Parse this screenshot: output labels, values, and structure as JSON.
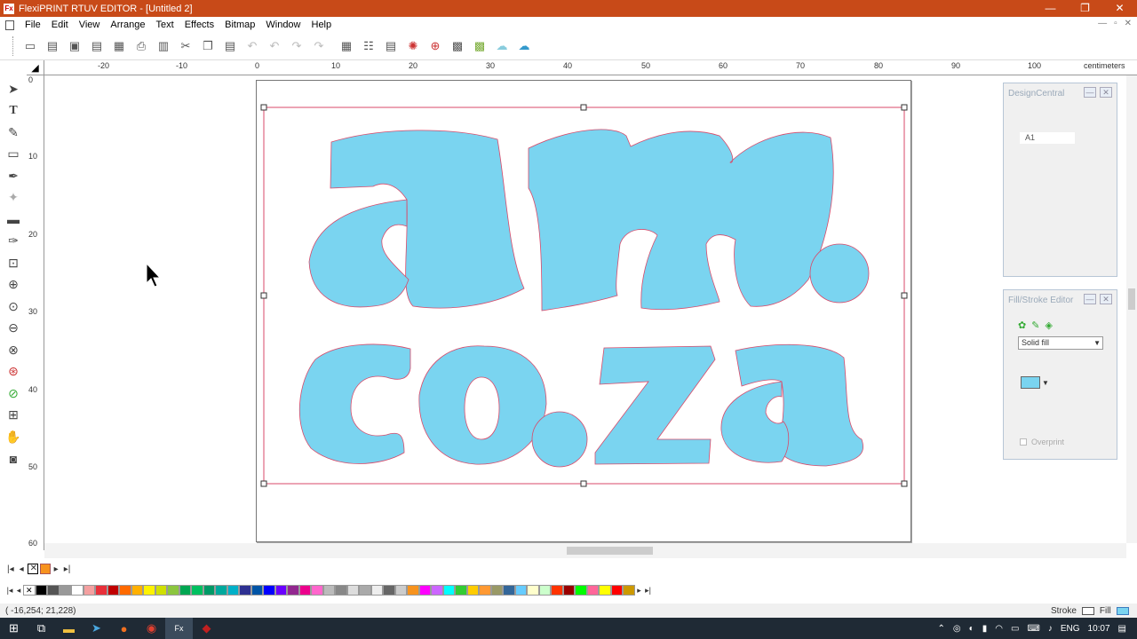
{
  "window": {
    "title": "FlexiPRINT RTUV EDITOR - [Untitled 2]",
    "app_icon": "Fx",
    "controls": [
      "—",
      "❐",
      "✕"
    ]
  },
  "menu": {
    "items": [
      "File",
      "Edit",
      "View",
      "Arrange",
      "Text",
      "Effects",
      "Bitmap",
      "Window",
      "Help"
    ],
    "mdi_controls": [
      "—",
      "▫",
      "✕"
    ]
  },
  "toolbar": {
    "icons": [
      "new-icon",
      "open-icon",
      "save-icon",
      "save-as-icon",
      "print-preview-icon",
      "print-icon",
      "rip-icon",
      "cut-icon",
      "copy-icon",
      "paste-icon",
      "undo-icon",
      "undo-all-icon",
      "redo-icon",
      "redo-all-icon",
      "arrange-icon",
      "align-icon",
      "layer-icon",
      "color-wheel-icon",
      "zoom-icon",
      "grid-icon",
      "color-icon",
      "cloud-icon",
      "upload-icon"
    ]
  },
  "ruler": {
    "unit": "centimeters",
    "h_labels": [
      "-20",
      "-10",
      "0",
      "10",
      "20",
      "30",
      "40",
      "50",
      "60",
      "70",
      "80",
      "90",
      "100"
    ],
    "v_labels": [
      "0",
      "10",
      "20",
      "30",
      "40",
      "50",
      "60"
    ]
  },
  "artwork": {
    "line1": "am.",
    "line2": "co.za",
    "fill_color": "#7ad4f0",
    "outline_color": "#d84a6a"
  },
  "design_central": {
    "title": "DesignCentral",
    "item": "A1"
  },
  "fill_stroke": {
    "title": "Fill/Stroke Editor",
    "fill_type": "Solid fill",
    "swatch_color": "#7ad4f0",
    "overprint_label": "Overprint"
  },
  "palette": {
    "colors": [
      "#000000",
      "#555555",
      "#999999",
      "#ffffff",
      "#f4a0a0",
      "#e8303a",
      "#c00000",
      "#ff6a00",
      "#ffb000",
      "#fff200",
      "#d0e000",
      "#8cc63f",
      "#00a651",
      "#00c060",
      "#009966",
      "#00a99d",
      "#00b0c8",
      "#2e3192",
      "#0054a6",
      "#0000ff",
      "#6a00ff",
      "#92278f",
      "#ec008c",
      "#ff66cc",
      "#bbbbbb",
      "#888888",
      "#dddddd",
      "#aaaaaa",
      "#eeeeee",
      "#666666",
      "#cccccc",
      "#f7931e",
      "#ff00ff",
      "#cc66ff",
      "#00ffff",
      "#33cc33",
      "#ffcc00",
      "#ff9933",
      "#999966",
      "#336699",
      "#66ccff",
      "#ffffcc",
      "#ccffcc",
      "#ff3300",
      "#990000",
      "#00ff00",
      "#ff6699",
      "#ffff00",
      "#ff0000",
      "#cc9900"
    ]
  },
  "status": {
    "coords": "( -16,254;  21,228)",
    "stroke_label": "Stroke",
    "fill_label": "Fill"
  },
  "taskbar": {
    "language": "ENG",
    "time": "10:07"
  }
}
